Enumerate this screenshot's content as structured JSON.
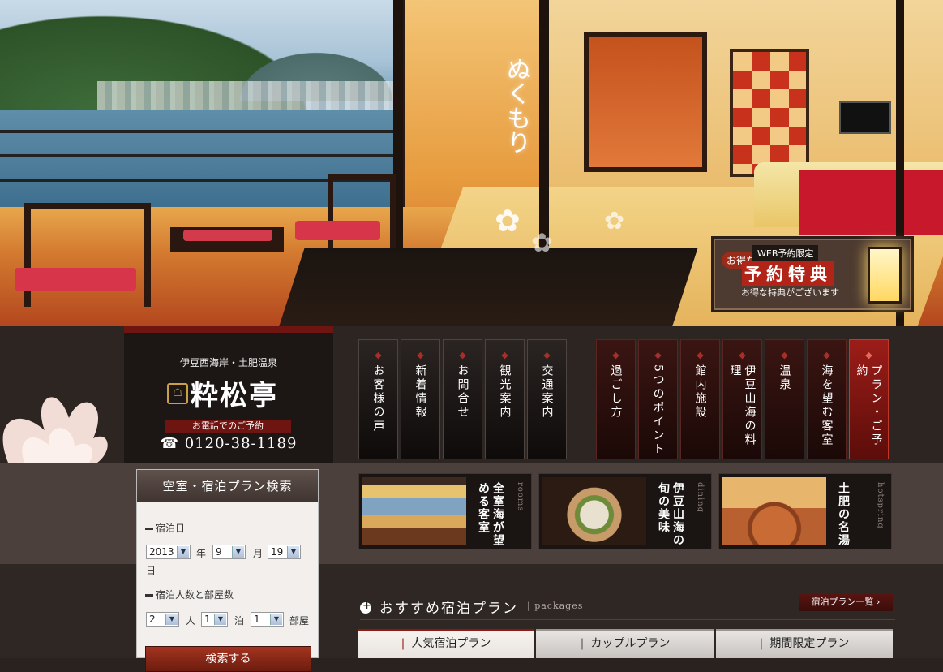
{
  "hero": {
    "calligraphy": "ぬくもり",
    "promo": {
      "chip": "お得な",
      "web_label": "WEB予約限定",
      "title": "予約特典",
      "sub": "お得な特典がございます"
    }
  },
  "brand": {
    "subtitle": "伊豆西海岸・土肥温泉",
    "logo_text": "粋松亭",
    "tel_label": "お電話でのご予約",
    "tel": "☎ 0120-38-1189"
  },
  "nav_primary": [
    {
      "label": "お客様の声"
    },
    {
      "label": "新着情報"
    },
    {
      "label": "お問合せ"
    },
    {
      "label": "観光案内"
    },
    {
      "label": "交通案内"
    }
  ],
  "nav_secondary": [
    {
      "label": "過ごし方"
    },
    {
      "label": "5つのポイント"
    },
    {
      "label": "館内施設"
    },
    {
      "label": "伊豆山海の料理"
    },
    {
      "label": "温泉"
    },
    {
      "label": "海を望む客室"
    },
    {
      "label": "プラン・ご予約"
    }
  ],
  "features": [
    {
      "caption": "全室海が望める客室",
      "en": "rooms"
    },
    {
      "caption": "伊豆山海の旬の美味",
      "en": "dining"
    },
    {
      "caption": "土肥の名湯",
      "en": "hotspring"
    }
  ],
  "search": {
    "title": "空室・宿泊プラン検索",
    "date_label": "宿泊日",
    "year": "2013",
    "year_unit": "年",
    "month": "9",
    "month_unit": "月",
    "day": "19",
    "day_unit": "日",
    "people_label": "宿泊人数と部屋数",
    "people": "2",
    "people_unit": "人",
    "nights": "1",
    "nights_unit": "泊",
    "rooms": "1",
    "rooms_unit": "部屋",
    "submit": "検索する"
  },
  "recommended": {
    "title": "おすすめ宿泊プラン",
    "en": "packages",
    "more": "宿泊プラン一覧",
    "tabs": [
      {
        "label": "人気宿泊プラン"
      },
      {
        "label": "カップルプラン"
      },
      {
        "label": "期間限定プラン"
      }
    ]
  },
  "colors": {
    "accent_red": "#8e1a14",
    "dark_bg": "#2d2521"
  }
}
